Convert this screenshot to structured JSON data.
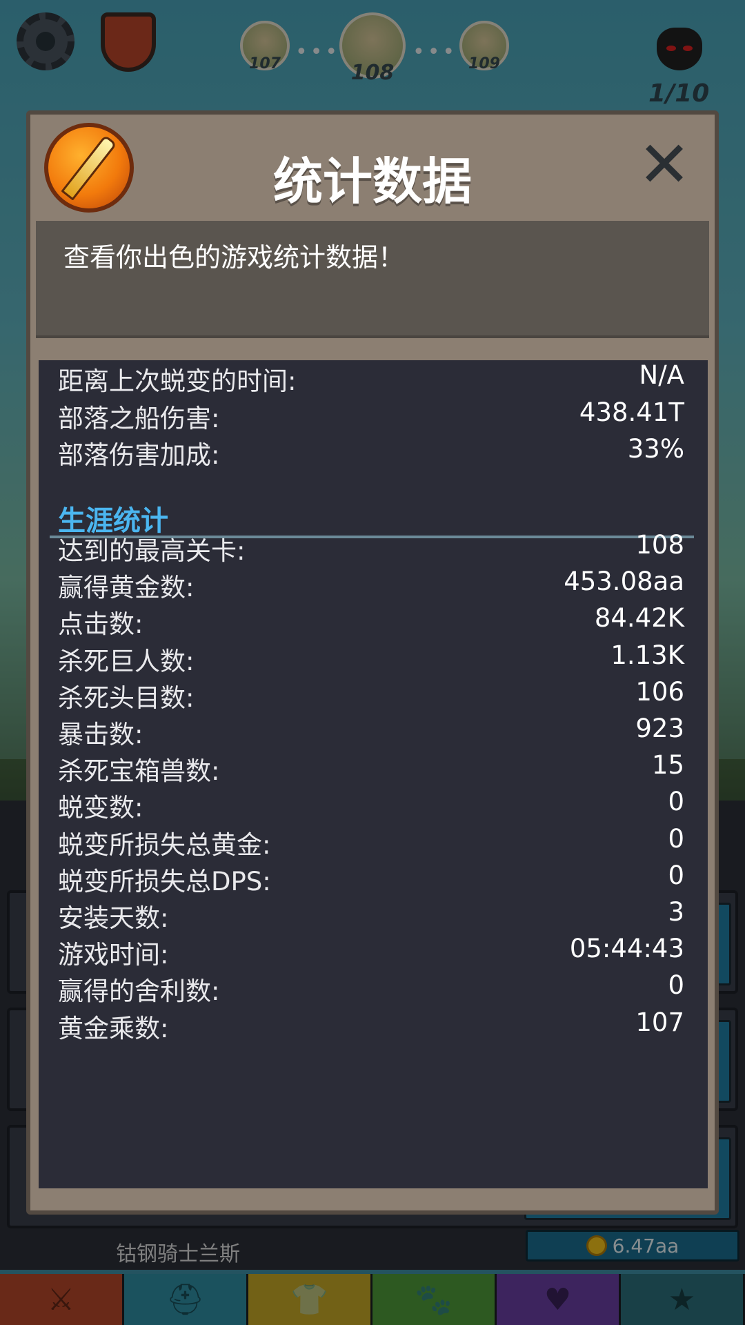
{
  "hud": {
    "stages": [
      "107",
      "108",
      "109"
    ],
    "wave": "1/10"
  },
  "modal": {
    "title": "统计数据",
    "description": "查看你出色的游戏统计数据！",
    "close_icon": "close-icon",
    "badge_icon": "sword-icon",
    "top_stats": [
      {
        "label": "距离上次蜕变的时间:",
        "value": "N/A"
      },
      {
        "label": "部落之船伤害:",
        "value": "438.41T"
      },
      {
        "label": "部落伤害加成:",
        "value": "33%"
      }
    ],
    "section_title": "生涯统计",
    "career_stats": [
      {
        "label": "达到的最高关卡:",
        "value": "108"
      },
      {
        "label": "赢得黄金数:",
        "value": "453.08aa"
      },
      {
        "label": "点击数:",
        "value": "84.42K"
      },
      {
        "label": "杀死巨人数:",
        "value": "1.13K"
      },
      {
        "label": "杀死头目数:",
        "value": "106"
      },
      {
        "label": "暴击数:",
        "value": "923"
      },
      {
        "label": "杀死宝箱兽数:",
        "value": "15"
      },
      {
        "label": "蜕变数:",
        "value": "0"
      },
      {
        "label": "蜕变所损失总黄金:",
        "value": "0"
      },
      {
        "label": "蜕变所损失总DPS:",
        "value": "0"
      },
      {
        "label": "安装天数:",
        "value": "3"
      },
      {
        "label": "游戏时间:",
        "value": "05:44:43"
      },
      {
        "label": "赢得的舍利数:",
        "value": "0"
      },
      {
        "label": "黄金乘数:",
        "value": "107"
      }
    ]
  },
  "hero": {
    "name": "钴钢骑士兰斯",
    "cost": "6.47aa"
  },
  "tabs": [
    {
      "icon": "sword-tab-icon",
      "glyph": "⚔",
      "color": "#b5482a"
    },
    {
      "icon": "viking-helmet-icon",
      "glyph": "⛑",
      "color": "#2f8ea3"
    },
    {
      "icon": "armor-icon",
      "glyph": "👕",
      "color": "#c4a826"
    },
    {
      "icon": "pet-icon",
      "glyph": "🐾",
      "color": "#4f9a3a"
    },
    {
      "icon": "heart-icon",
      "glyph": "♥",
      "color": "#6a3fa3"
    },
    {
      "icon": "star-icon",
      "glyph": "★",
      "color": "#2c6f7a"
    }
  ],
  "colors": {
    "section_title": "#4bb6f0",
    "modal_frame": "#8c7f72",
    "stats_bg": "#2b2c37"
  }
}
